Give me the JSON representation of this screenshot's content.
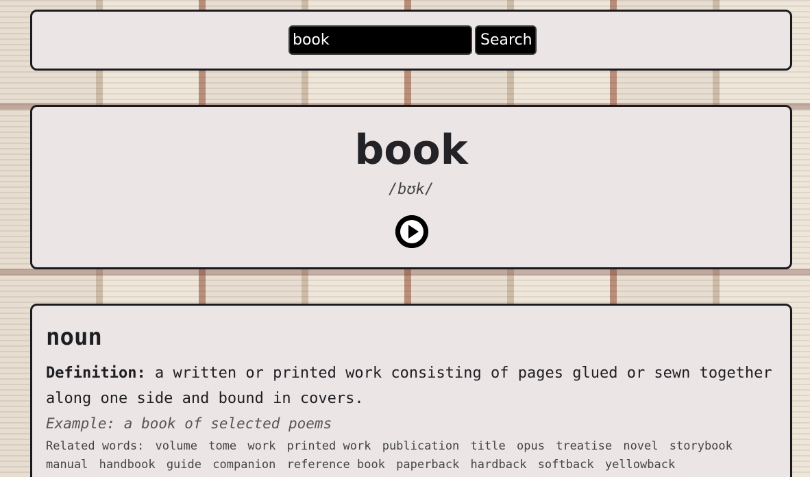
{
  "search": {
    "value": "book",
    "placeholder": "",
    "button_label": "Search"
  },
  "word": {
    "title": "book",
    "phonetic": "/bʊk/",
    "play_icon": "play-icon"
  },
  "meaning": {
    "part_of_speech": "noun",
    "definition_label": "Definition:",
    "definition_text": "a written or printed work consisting of pages glued or sewn together along one side and bound in covers.",
    "example": "Example: a book of selected poems",
    "related_label": "Related words:",
    "related_words": [
      "volume",
      "tome",
      "work",
      "printed work",
      "publication",
      "title",
      "opus",
      "treatise",
      "novel",
      "storybook",
      "manual",
      "handbook",
      "guide",
      "companion",
      "reference book",
      "paperback",
      "hardback",
      "softback",
      "yellowback"
    ]
  },
  "colors": {
    "panel_bg": "#ebe5e5",
    "panel_border": "#1b1b1f",
    "input_bg": "#000000"
  }
}
